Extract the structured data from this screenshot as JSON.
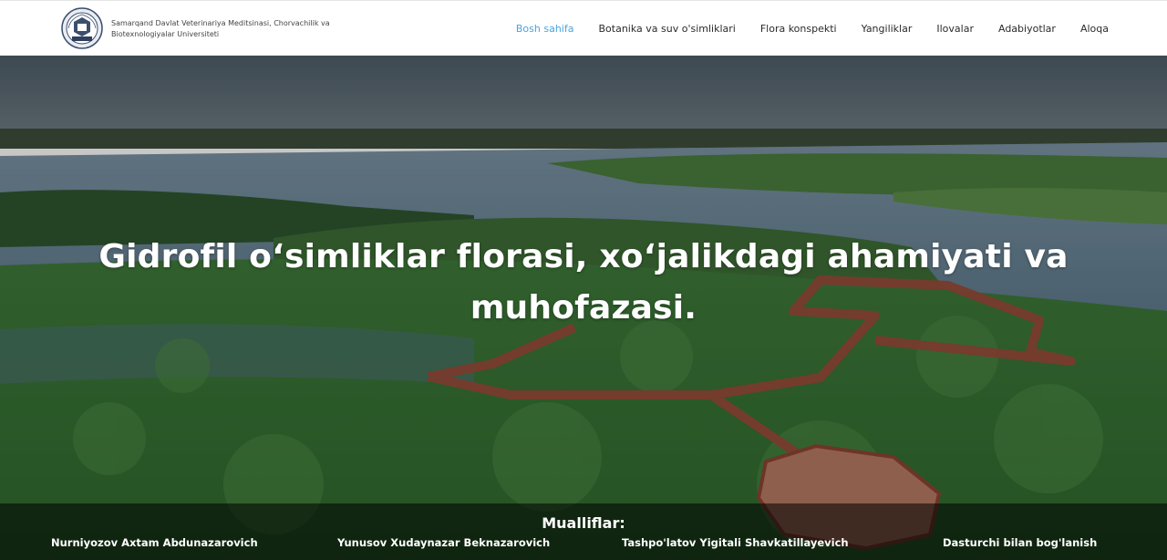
{
  "header": {
    "logo_icon": "university-emblem-icon",
    "brand_text": "Samarqand Davlat Veterinariya Meditsinasi, Chorvachilik va Biotexnologiyalar Universiteti",
    "nav": [
      {
        "label": "Bosh sahifa",
        "active": true
      },
      {
        "label": "Botanika va suv o'simliklari",
        "active": false
      },
      {
        "label": "Flora konspekti",
        "active": false
      },
      {
        "label": "Yangiliklar",
        "active": false
      },
      {
        "label": "Ilovalar",
        "active": false
      },
      {
        "label": "Adabiyotlar",
        "active": false
      },
      {
        "label": "Aloqa",
        "active": false
      }
    ],
    "active_color": "#4ba3dc"
  },
  "hero": {
    "title_line1": "Gidrofil o‘simliklar florasi, xo‘jalikdagi ahamiyati va",
    "title_line2": "muhofazasi."
  },
  "authors": {
    "title": "Mualliflar:",
    "items": [
      "Nurniyozov Axtam Abdunazarovich",
      "Yunusov Xudaynazar Beknazarovich",
      "Tashpo'latov Yigitali Shavkatillayevich",
      "Dasturchi bilan bog'lanish"
    ]
  }
}
